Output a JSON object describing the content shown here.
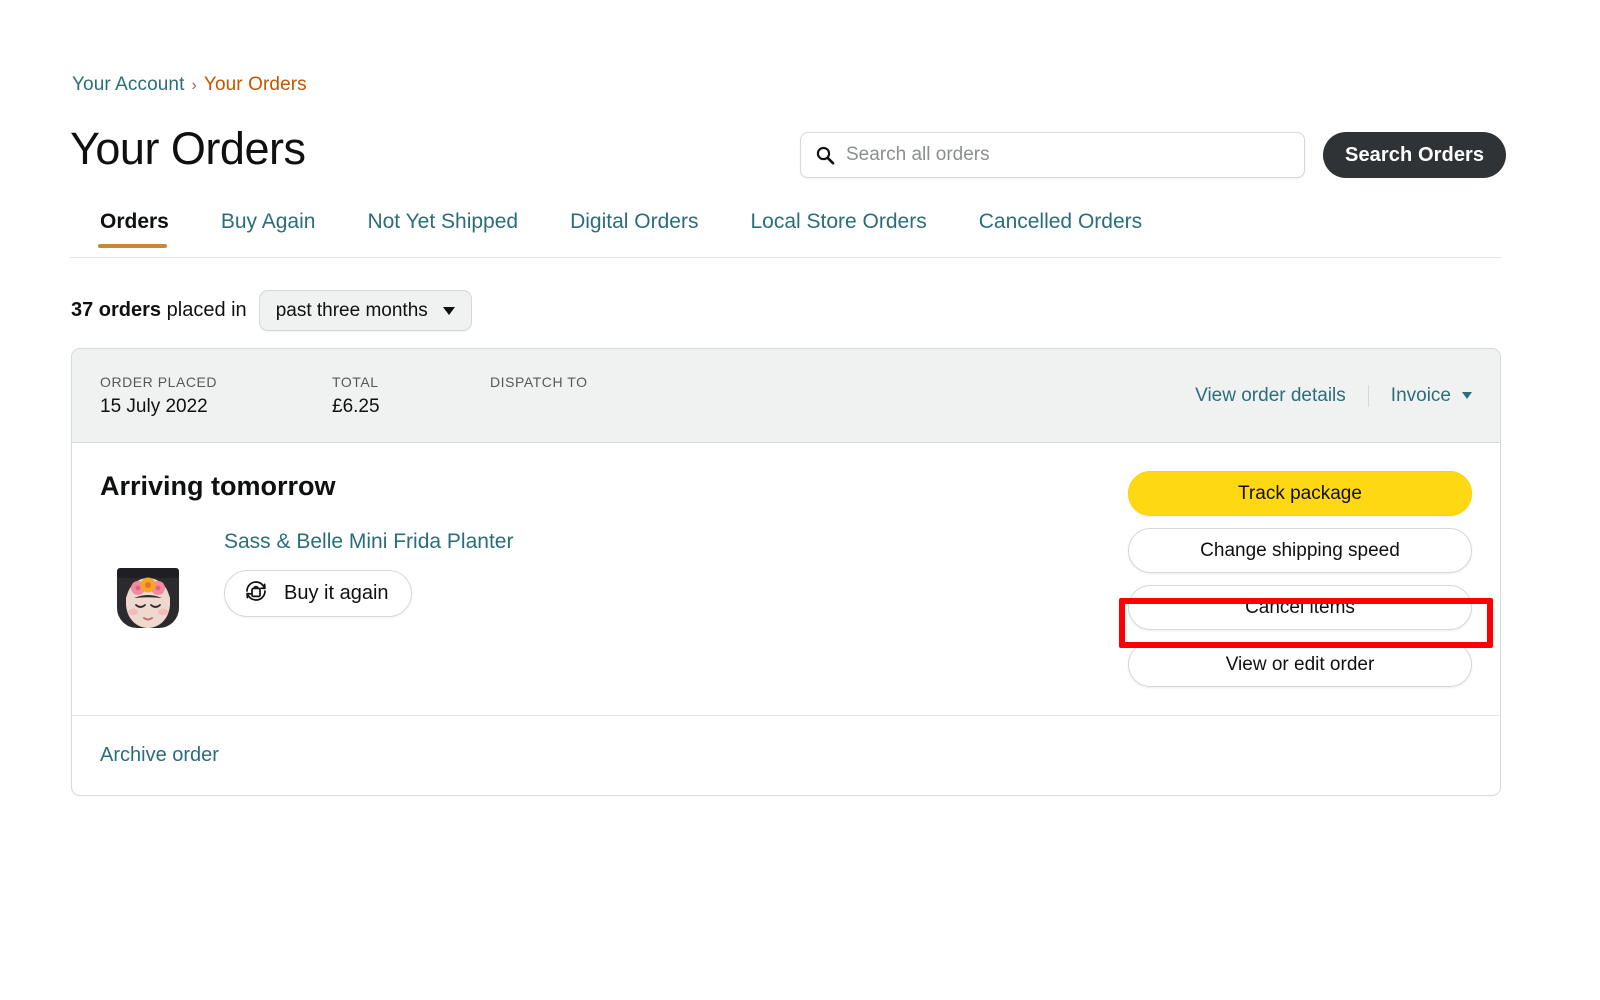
{
  "breadcrumb": {
    "account_label": "Your Account",
    "separator": "›",
    "current_label": "Your Orders"
  },
  "header": {
    "title": "Your Orders"
  },
  "search": {
    "placeholder": "Search all orders",
    "value": "",
    "button_label": "Search Orders",
    "icon": "search-icon"
  },
  "tabs": [
    {
      "label": "Orders",
      "active": true
    },
    {
      "label": "Buy Again",
      "active": false
    },
    {
      "label": "Not Yet Shipped",
      "active": false
    },
    {
      "label": "Digital Orders",
      "active": false
    },
    {
      "label": "Local Store Orders",
      "active": false
    },
    {
      "label": "Cancelled Orders",
      "active": false
    }
  ],
  "filter": {
    "count_text": "37 orders",
    "placed_in_text": "placed in",
    "range_selected": "past three months",
    "range_icon": "chevron-down-icon"
  },
  "order": {
    "header": {
      "order_placed_label": "ORDER PLACED",
      "order_placed_value": "15 July 2022",
      "total_label": "TOTAL",
      "total_value": "£6.25",
      "dispatch_label": "DISPATCH TO",
      "dispatch_value": "",
      "view_details_label": "View order details",
      "invoice_label": "Invoice",
      "invoice_icon": "chevron-down-icon"
    },
    "status": "Arriving tomorrow",
    "item": {
      "title": "Sass & Belle Mini Frida Planter",
      "buy_again_label": "Buy it again",
      "buy_again_icon": "buy-again-refresh-bag-icon",
      "thumbnail_alt": "frida-planter-thumbnail"
    },
    "actions": [
      {
        "label": "Track package",
        "style": "primary",
        "highlighted": false
      },
      {
        "label": "Change shipping speed",
        "style": "secondary",
        "highlighted": false
      },
      {
        "label": "Cancel items",
        "style": "secondary",
        "highlighted": true
      },
      {
        "label": "View or edit order",
        "style": "secondary",
        "highlighted": false
      }
    ],
    "footer": {
      "archive_label": "Archive order"
    }
  },
  "colors": {
    "link_teal": "#2a6e7a",
    "breadcrumb_orange": "#c45500",
    "tab_underline": "#c8883c",
    "amazon_yellow": "#ffd814",
    "search_button_dark": "#2f3335",
    "card_header_gray": "#f0f2f2",
    "border_gray": "#d5d9d9",
    "highlight_red": "#ff0000"
  }
}
